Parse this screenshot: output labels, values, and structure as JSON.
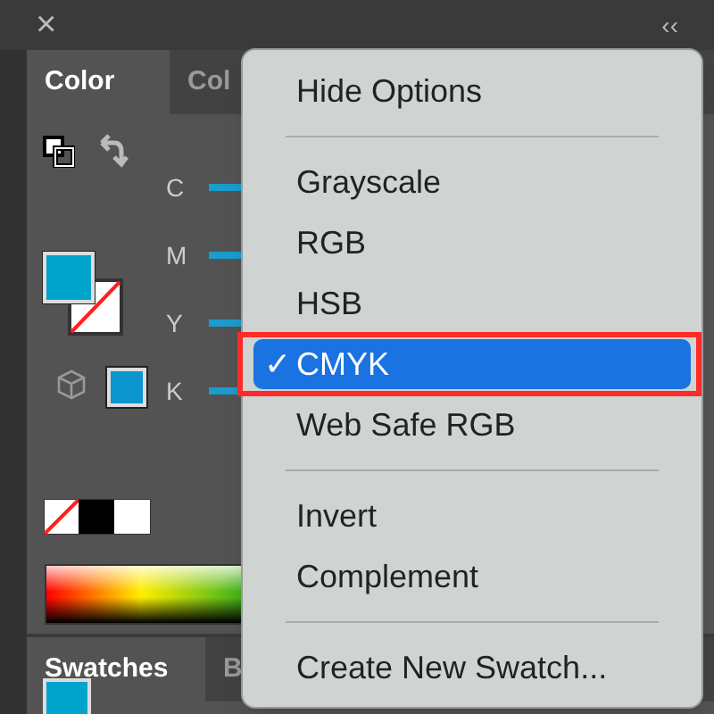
{
  "top_bar": {
    "close": "×",
    "collapse": "‹‹"
  },
  "color_panel": {
    "tabs": [
      {
        "label": "Color",
        "selected": true
      },
      {
        "label": "Col",
        "selected": false
      }
    ],
    "channels": [
      {
        "label": "C"
      },
      {
        "label": "M"
      },
      {
        "label": "Y"
      },
      {
        "label": "K"
      }
    ]
  },
  "swatches_panel": {
    "tabs": [
      {
        "label": "Swatches",
        "selected": true
      },
      {
        "label": "B",
        "selected": false
      }
    ]
  },
  "menu": {
    "items": [
      {
        "kind": "item",
        "label": "Hide Options",
        "selected": false,
        "checked": false,
        "outlined": false
      },
      {
        "kind": "separator"
      },
      {
        "kind": "item",
        "label": "Grayscale",
        "selected": false,
        "checked": false,
        "outlined": false
      },
      {
        "kind": "item",
        "label": "RGB",
        "selected": false,
        "checked": false,
        "outlined": false
      },
      {
        "kind": "item",
        "label": "HSB",
        "selected": false,
        "checked": false,
        "outlined": false
      },
      {
        "kind": "item",
        "label": "CMYK",
        "selected": true,
        "checked": true,
        "outlined": true
      },
      {
        "kind": "item",
        "label": "Web Safe RGB",
        "selected": false,
        "checked": false,
        "outlined": false
      },
      {
        "kind": "separator"
      },
      {
        "kind": "item",
        "label": "Invert",
        "selected": false,
        "checked": false,
        "outlined": false
      },
      {
        "kind": "item",
        "label": "Complement",
        "selected": false,
        "checked": false,
        "outlined": false
      },
      {
        "kind": "separator"
      },
      {
        "kind": "item",
        "label": "Create New Swatch...",
        "selected": false,
        "checked": false,
        "outlined": false
      }
    ],
    "check": "✓"
  }
}
